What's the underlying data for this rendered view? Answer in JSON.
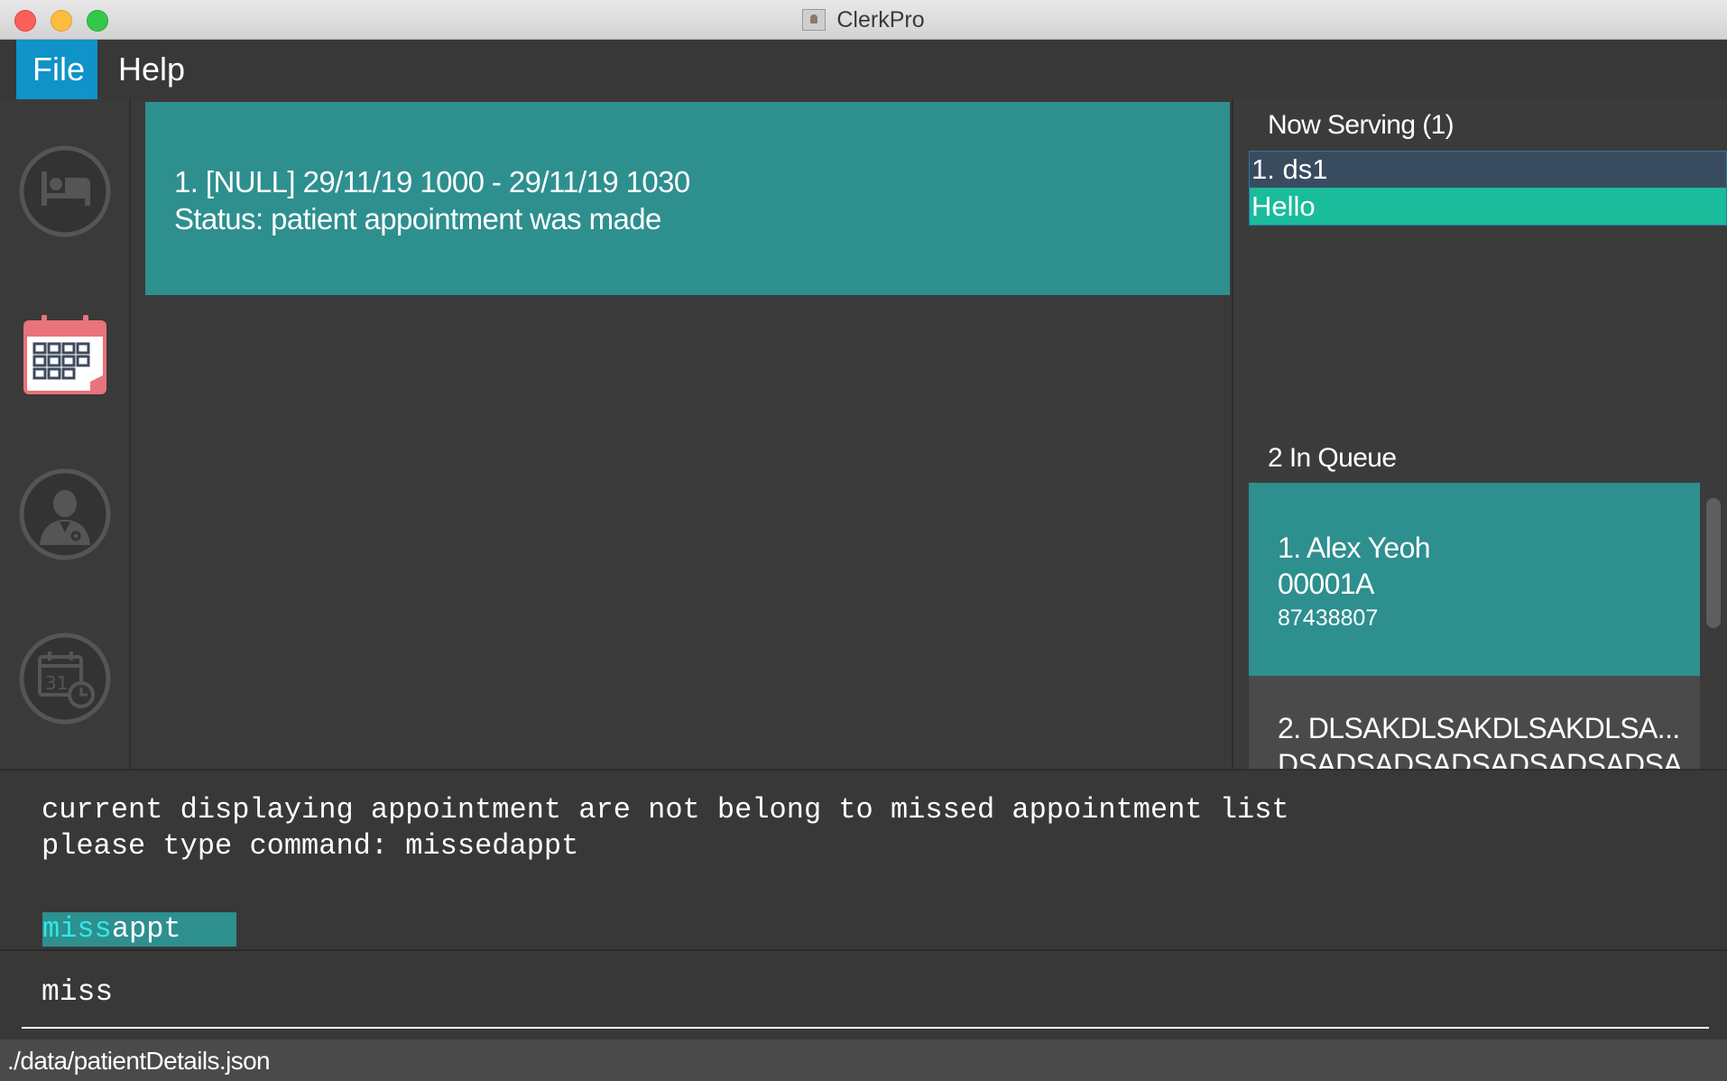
{
  "window": {
    "title": "ClerkPro"
  },
  "menu": {
    "items": [
      {
        "label": "File"
      },
      {
        "label": "Help"
      }
    ]
  },
  "sidebar": {
    "icons": [
      "bed-icon",
      "calendar-icon",
      "doctor-icon",
      "missed-calendar-icon"
    ]
  },
  "appointments": [
    {
      "line1": "1.  [NULL]  29/11/19 1000 - 29/11/19 1030",
      "line2": "Status: patient appointment was made"
    }
  ],
  "now_serving": {
    "title": "Now Serving (1)",
    "rows": [
      "1. ds1",
      "Hello"
    ]
  },
  "queue": {
    "title": "2 In Queue",
    "items": [
      {
        "name": "1.  Alex Yeoh",
        "id": "00001A",
        "phone": "87438807"
      },
      {
        "name": "2.  DLSAKDLSAKDLSAKDLSA...",
        "overflow": "DSADSADSADSADSADSADSA"
      }
    ]
  },
  "result": {
    "message": "current displaying appointment are not belong to missed appointment list\nplease type command: missedappt",
    "suggestion_match": "miss",
    "suggestion_rest": "appt"
  },
  "command": {
    "value": "miss"
  },
  "status": {
    "path": "./data/patientDetails.json"
  },
  "colors": {
    "accent": "#0f93c9",
    "card": "#2e8f8f",
    "selected": "#1abc9c",
    "background": "#3b3b3b"
  }
}
